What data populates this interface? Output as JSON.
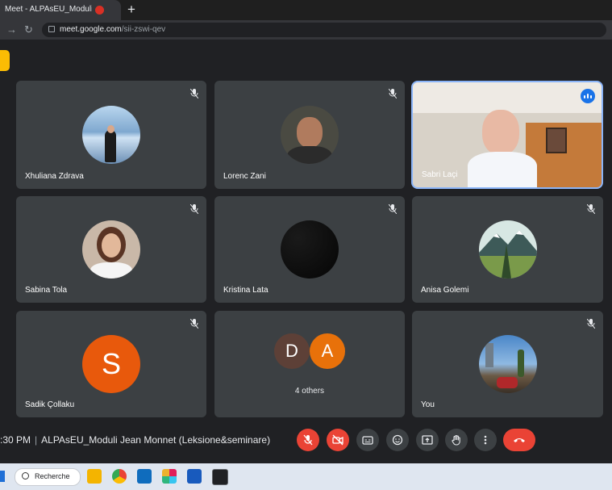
{
  "browser": {
    "tab_title": "Meet - ALPAsEU_Moduli Jean",
    "new_tab": "+",
    "url_host": "meet.google.com",
    "url_path": "/sii-zswi-qev"
  },
  "participants": [
    {
      "name": "Xhuliana Zdrava",
      "muted": true
    },
    {
      "name": "Lorenc Zani",
      "muted": true
    },
    {
      "name": "Sabri Laçi",
      "speaking": true
    },
    {
      "name": "Sabina Tola",
      "muted": true
    },
    {
      "name": "Kristina Lata",
      "muted": true
    },
    {
      "name": "Anisa Golemi",
      "muted": true
    },
    {
      "name": "Sadik Çollaku",
      "muted": true,
      "initial": "S"
    },
    {
      "others_initials": [
        "D",
        "A"
      ],
      "others_label": "4 others"
    },
    {
      "name": "You",
      "muted": true
    }
  ],
  "meeting": {
    "time": ":30 PM",
    "separator": "|",
    "title": "ALPAsEU_Moduli Jean Monnet (Leksione&seminare)"
  },
  "controls": [
    "mic-off",
    "camera-off",
    "captions",
    "emoji",
    "present",
    "raise-hand",
    "more",
    "end-call"
  ],
  "taskbar": {
    "search_label": "Recherche"
  },
  "colors": {
    "background": "#202124",
    "tile": "#3c4043",
    "danger": "#ea4335",
    "accent": "#8ab4f8"
  }
}
